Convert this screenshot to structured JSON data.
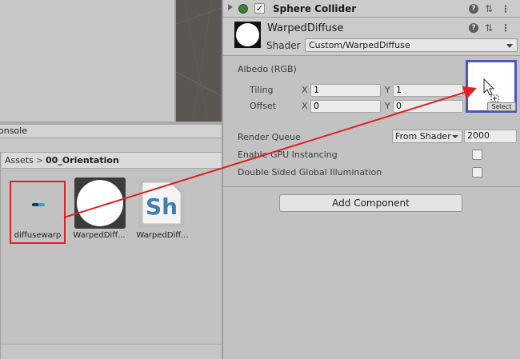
{
  "console": {
    "tab_label": "onsole"
  },
  "project": {
    "breadcrumb": {
      "root": "Assets",
      "separator": ">",
      "current": "00_Orientation"
    },
    "assets": [
      {
        "label": "diffusewarp"
      },
      {
        "label": "WarpedDiff..."
      },
      {
        "label": "WarpedDiff..."
      }
    ],
    "shader_icon_text": "Sh"
  },
  "inspector": {
    "component": {
      "title": "Sphere Collider",
      "checked": "✓"
    },
    "material": {
      "name": "WarpedDiffuse",
      "shader_label": "Shader",
      "shader_value": "Custom/WarpedDiffuse"
    },
    "albedo": {
      "label": "Albedo (RGB)",
      "tiling_label": "Tiling",
      "offset_label": "Offset",
      "x_axis": "X",
      "y_axis": "Y",
      "tiling_x": "1",
      "tiling_y": "1",
      "offset_x": "0",
      "offset_y": "0",
      "select_label": "Select"
    },
    "render_queue": {
      "label": "Render Queue",
      "mode": "From Shader",
      "value": "2000"
    },
    "gpu_instancing_label": "Enable GPU Instancing",
    "double_sided_label": "Double Sided Global Illumination",
    "add_component_label": "Add Component"
  },
  "colors": {
    "highlight_red": "#e0201e",
    "slot_border": "#4a56b8",
    "shader_icon_blue": "#3f7fb0"
  },
  "icons": [
    "fold-arrow-icon",
    "gameobject-enabled-icon",
    "help-icon",
    "presets-icon",
    "context-menu-icon",
    "texture-icon",
    "material-sphere-icon",
    "shader-icon",
    "drag-cursor-icon"
  ]
}
